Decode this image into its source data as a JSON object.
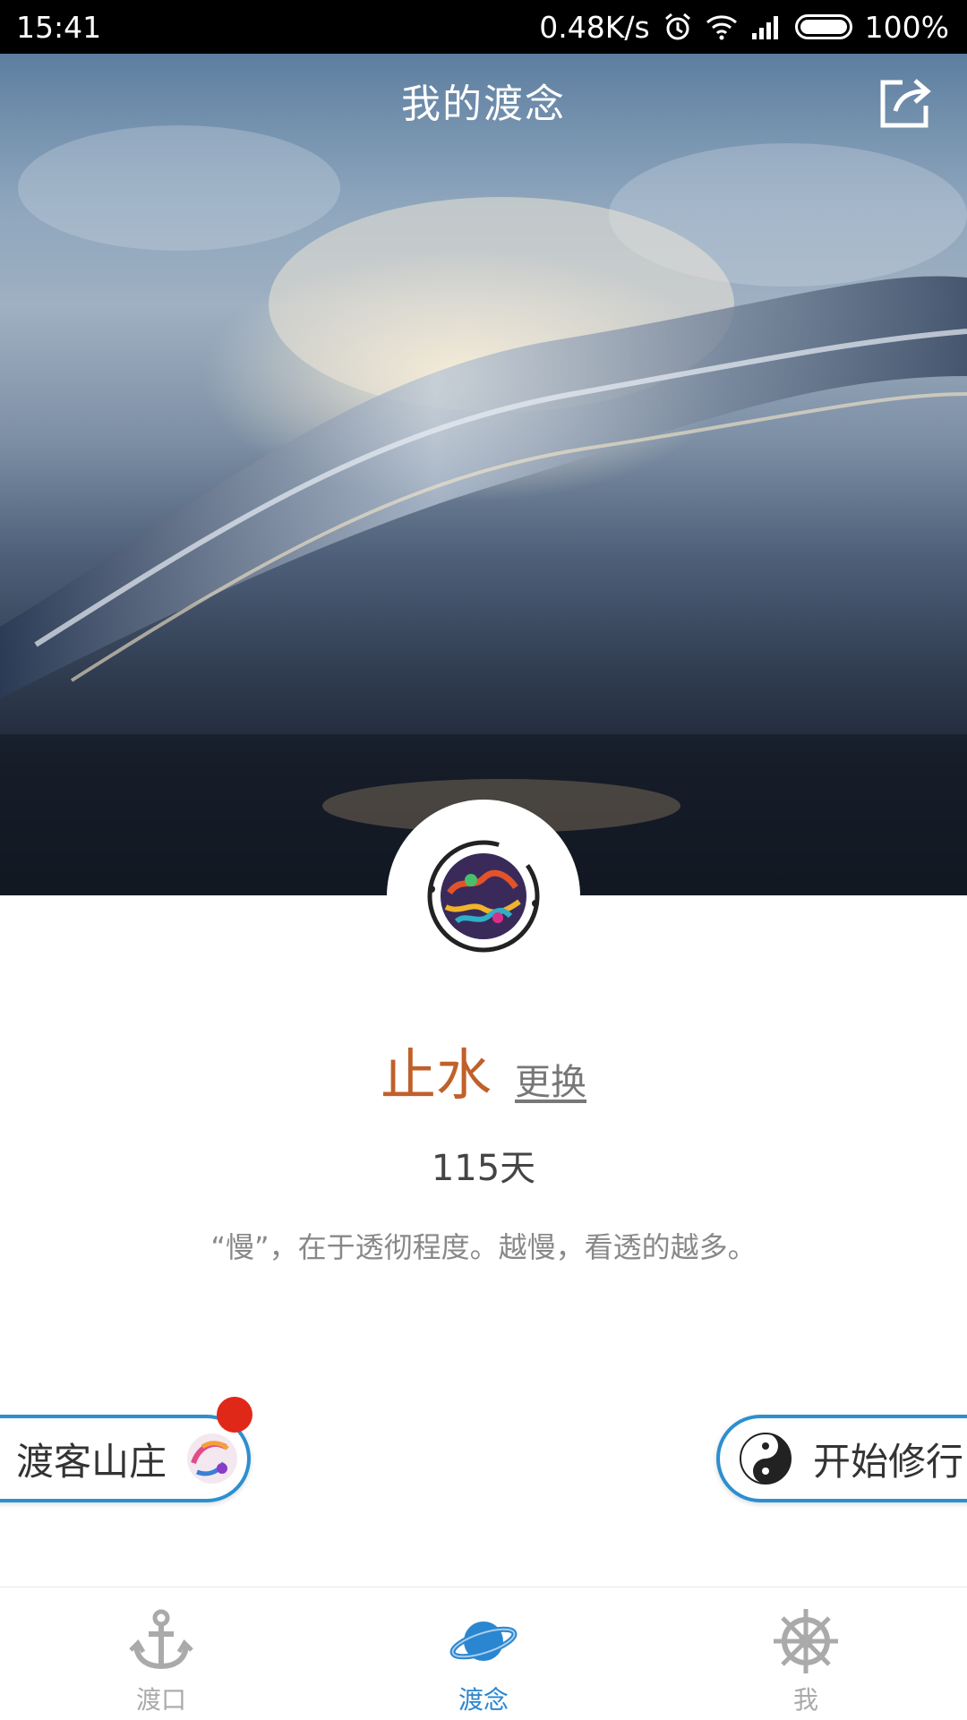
{
  "status_bar": {
    "time": "15:41",
    "net_speed": "0.48K/s",
    "battery": "100%",
    "icons": [
      "alarm-icon",
      "wifi-icon",
      "signal-icon",
      "battery-icon"
    ]
  },
  "header": {
    "title": "我的渡念",
    "share_icon": "share-icon"
  },
  "profile": {
    "name": "止水",
    "change_label": "更换",
    "days": "115天",
    "quote": "“慢”，在于透彻程度。越慢，看透的越多。"
  },
  "actions": {
    "left": {
      "label": "渡客山庄",
      "icon": "painted-swirl-icon",
      "has_badge": true
    },
    "right": {
      "label": "开始修行",
      "icon": "yin-yang-icon"
    }
  },
  "bottom_nav": {
    "tabs": [
      {
        "label": "渡口",
        "icon": "anchor-icon",
        "active": false
      },
      {
        "label": "渡念",
        "icon": "planet-icon",
        "active": true
      },
      {
        "label": "我",
        "icon": "ship-wheel-icon",
        "active": false
      }
    ]
  },
  "colors": {
    "accent": "#2a86d0",
    "name": "#c0602a",
    "badge": "#e02818",
    "pill_border": "#2c8fd0"
  }
}
